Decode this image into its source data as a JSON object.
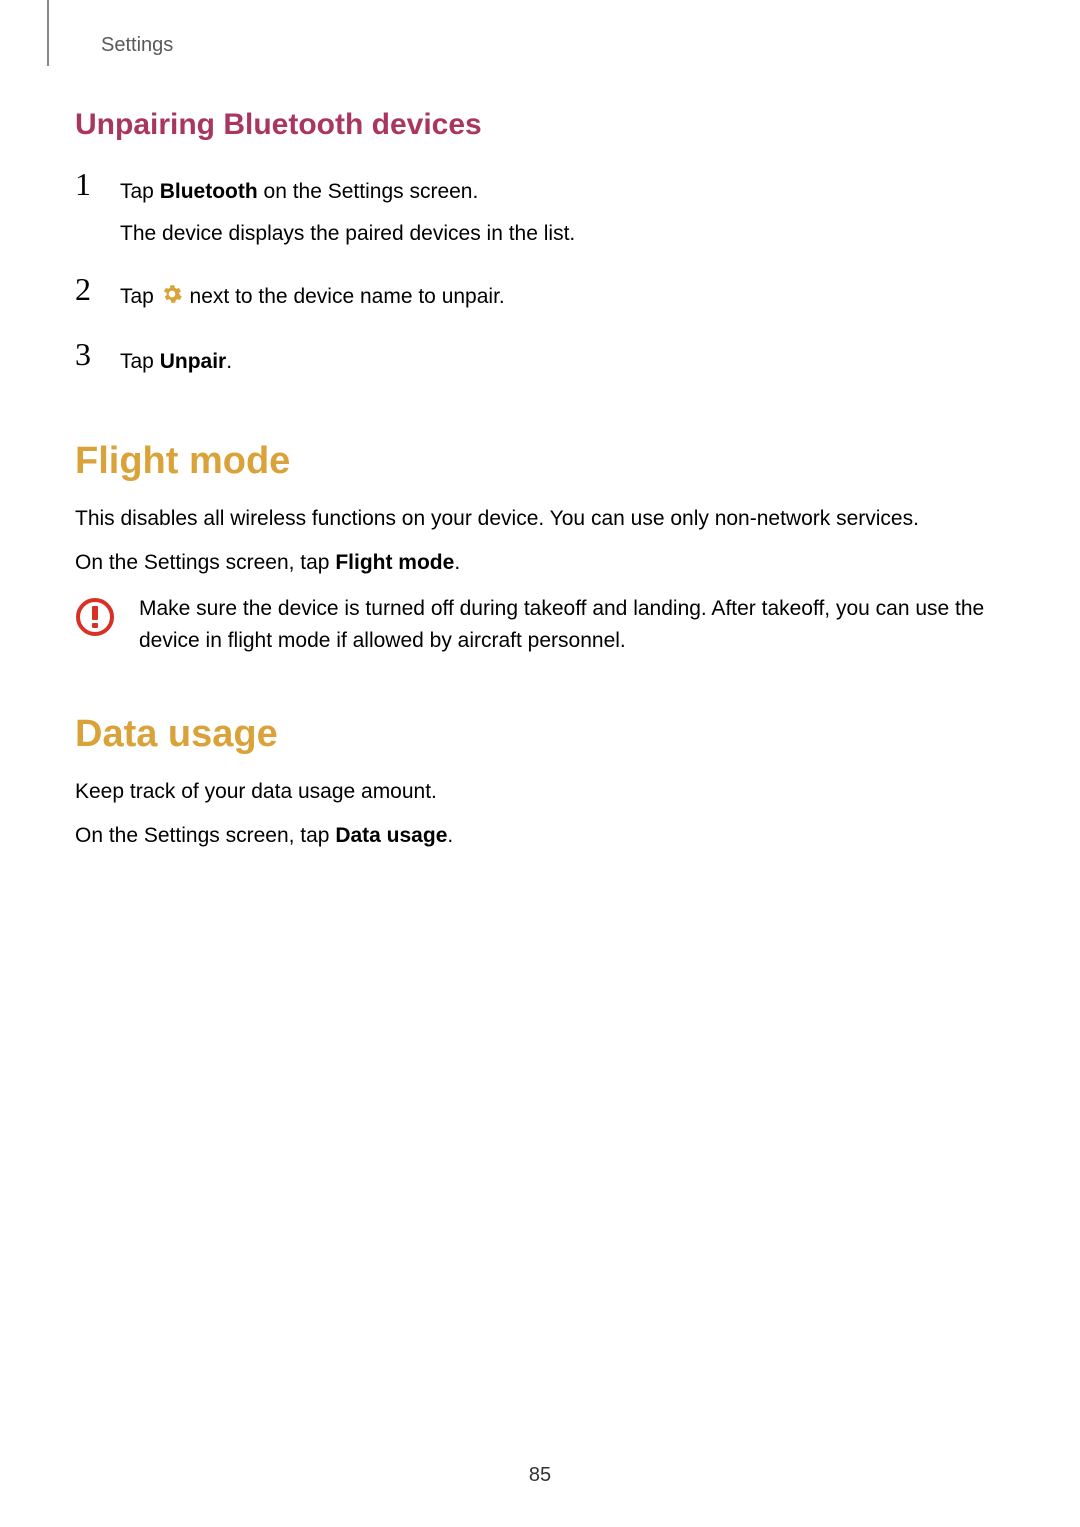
{
  "header": {
    "label": "Settings"
  },
  "section1": {
    "subheading": "Unpairing Bluetooth devices",
    "steps": [
      {
        "num": "1",
        "line1_pre": "Tap ",
        "line1_bold": "Bluetooth",
        "line1_post": " on the Settings screen.",
        "line2": "The device displays the paired devices in the list."
      },
      {
        "num": "2",
        "line1_pre": "Tap ",
        "line1_post": " next to the device name to unpair."
      },
      {
        "num": "3",
        "line1_pre": "Tap ",
        "line1_bold": "Unpair",
        "line1_post": "."
      }
    ]
  },
  "section2": {
    "heading": "Flight mode",
    "para1": "This disables all wireless functions on your device. You can use only non-network services.",
    "para2_pre": "On the Settings screen, tap ",
    "para2_bold": "Flight mode",
    "para2_post": ".",
    "callout": "Make sure the device is turned off during takeoff and landing. After takeoff, you can use the device in flight mode if allowed by aircraft personnel."
  },
  "section3": {
    "heading": "Data usage",
    "para1": "Keep track of your data usage amount.",
    "para2_pre": "On the Settings screen, tap ",
    "para2_bold": "Data usage",
    "para2_post": "."
  },
  "page_number": "85"
}
